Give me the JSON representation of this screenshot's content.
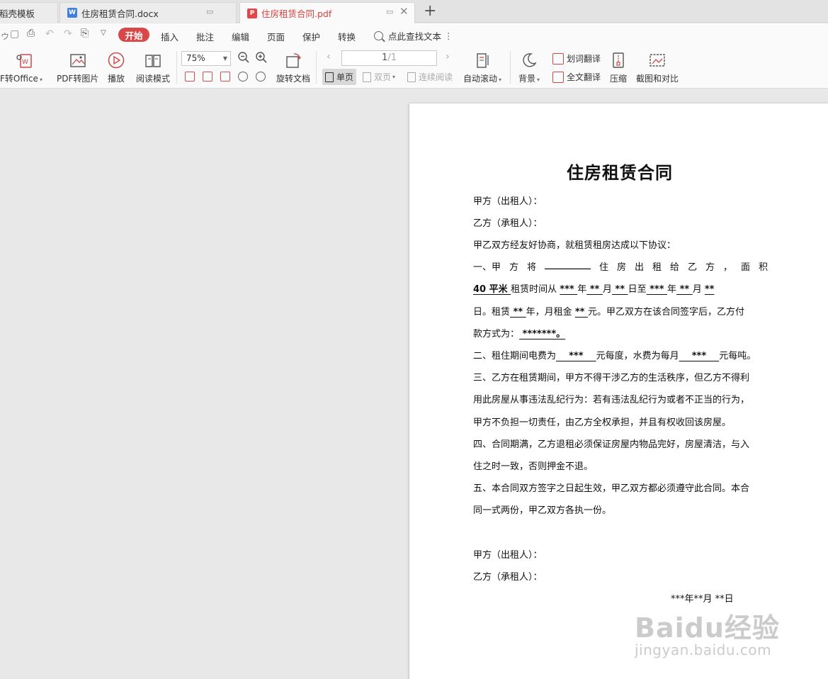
{
  "tabs": [
    {
      "label": "稻壳模板"
    },
    {
      "label": "住房租赁合同.docx",
      "icon": "word-doc-icon"
    },
    {
      "label": "住房租赁合同.pdf",
      "icon": "pdf-doc-icon",
      "active": true
    }
  ],
  "menu": {
    "start": "开始",
    "items": [
      "插入",
      "批注",
      "编辑",
      "页面",
      "保护",
      "转换"
    ],
    "search": "点此查找文本"
  },
  "toolbar": {
    "pdf_to_office": "F转Office",
    "pdf_to_image": "PDF转图片",
    "play": "播放",
    "read_mode": "阅读模式",
    "zoom": "75%",
    "rotate": "旋转文档",
    "page_current": "1",
    "page_total": "/1",
    "single_page": "单页",
    "double_page": "双页",
    "continuous": "连续阅读",
    "auto_scroll": "自动滚动",
    "background": "背景",
    "word_translate": "划词翻译",
    "full_translate": "全文翻译",
    "compress": "压缩",
    "screenshot_compare": "截图和对比"
  },
  "document": {
    "title": "住房租赁合同",
    "party_a": "甲方（出租人）：",
    "party_b": "乙方（承租人）：",
    "intro": "甲乙双方经友好协商，就租赁租房达成以下协议：",
    "c1_l1": [
      "一、甲",
      "方",
      "将",
      "__________",
      "住",
      "房",
      "出",
      "租",
      "给",
      "乙",
      "方",
      "，",
      "面",
      "积"
    ],
    "c1_l2": {
      "area": "40 平米 ",
      "t1": "租赁时间从 ",
      "y1": " *** ",
      "t2": "年",
      "m1": " ** ",
      "t3": "月",
      "d1": " ** ",
      "t4": "日至",
      "y2": " *** ",
      "t5": "年",
      "m2": " ** ",
      "t6": "月 ",
      "d2": " ** "
    },
    "c1_l3": {
      "t1": "日。租赁",
      "yrs": " ** ",
      "t2": "年，月租金 ",
      "rent": " ** ",
      "t3": "元。甲乙双方在该合同签字后，乙方付"
    },
    "c1_l4": {
      "t1": "款方式为：",
      "pay": " *******。"
    },
    "c2": {
      "t1": "二、租住期间电费为",
      "e": "    ***    ",
      "t2": "元每度，水费为每月",
      "w": "    ***    ",
      "t3": "元每吨。"
    },
    "c3": [
      "三、乙方在租赁期间，甲方不得干涉乙方的生活秩序，但乙方不得利",
      "用此房屋从事违法乱纪行为：若有违法乱纪行为或者不正当的行为，",
      "甲方不负担一切责任，由乙方全权承担，并且有权收回该房屋。"
    ],
    "c4": [
      "四、合同期满，乙方退租必须保证房屋内物品完好，房屋清洁，与入",
      "住之时一致，否则押金不退。"
    ],
    "c5": [
      "五、本合同双方签字之日起生效，甲乙双方都必须遵守此合同。本合",
      "同一式两份，甲乙双方各执一份。"
    ],
    "sign_a": "甲方（出租人）：",
    "sign_b": "乙方（承租人）：",
    "date": "***年**月 **日"
  },
  "watermark": {
    "logo": "Baidu经验",
    "url": "jingyan.baidu.com"
  }
}
